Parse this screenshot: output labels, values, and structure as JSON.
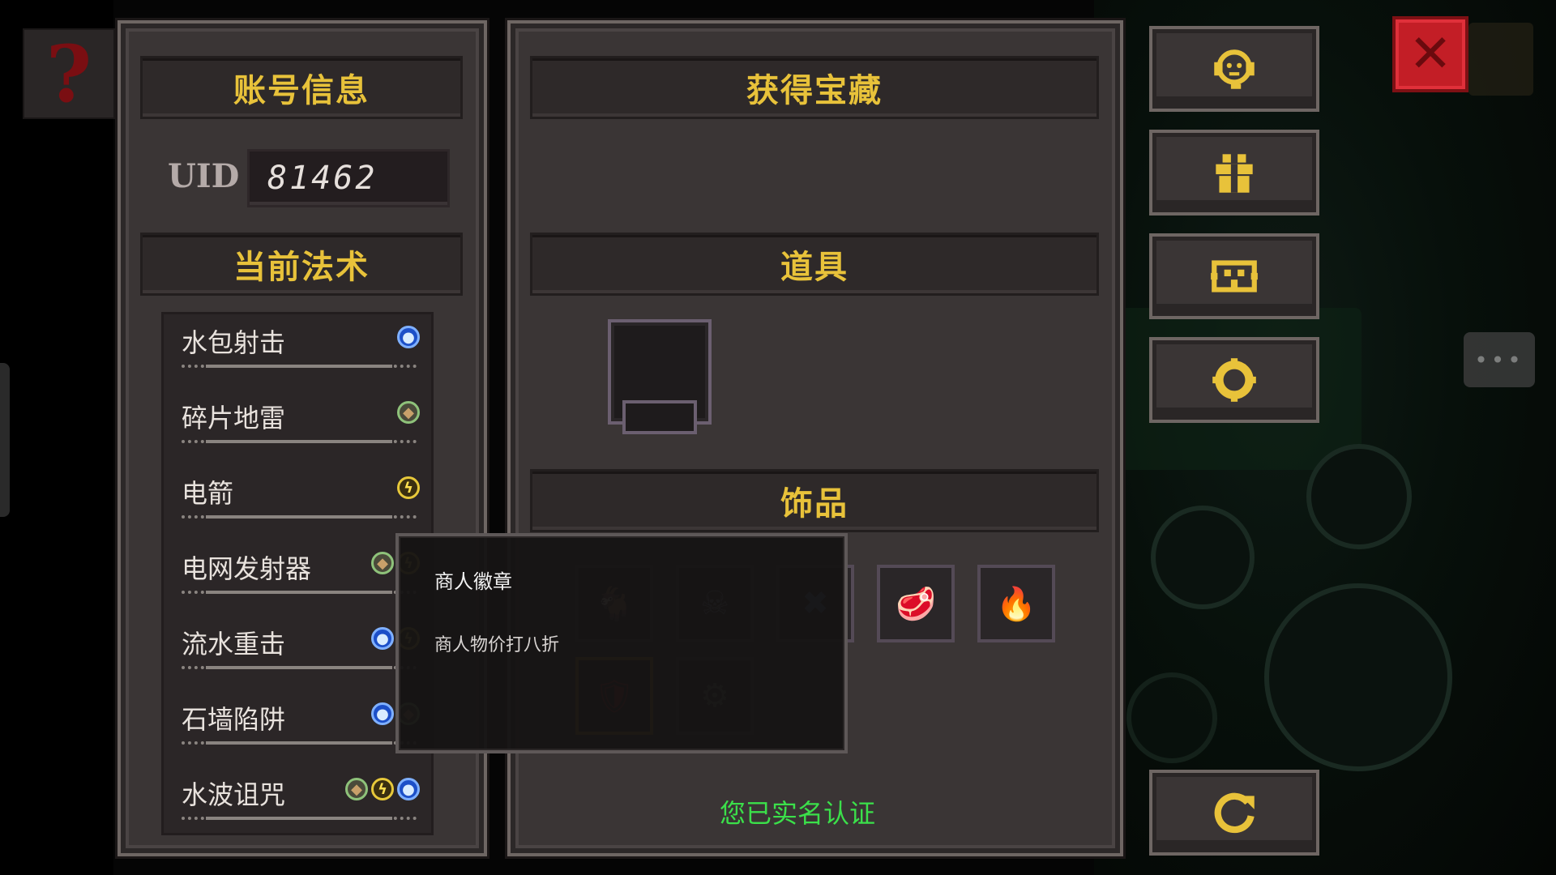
{
  "help_tile": {
    "symbol": "?"
  },
  "account_panel": {
    "header": "账号信息",
    "uid_label": "UID",
    "uid_value": "81462",
    "spells_header": "当前法术",
    "spells": [
      {
        "name": "水包射击",
        "elements": [
          "water"
        ]
      },
      {
        "name": "碎片地雷",
        "elements": [
          "earth"
        ]
      },
      {
        "name": "电箭",
        "elements": [
          "thunder"
        ]
      },
      {
        "name": "电网发射器",
        "elements": [
          "earth",
          "thunder"
        ]
      },
      {
        "name": "流水重击",
        "elements": [
          "water",
          "thunder"
        ]
      },
      {
        "name": "石墙陷阱",
        "elements": [
          "water",
          "earth"
        ]
      },
      {
        "name": "水波诅咒",
        "elements": [
          "earth",
          "thunder",
          "water"
        ]
      }
    ]
  },
  "treasure_panel": {
    "header": "获得宝藏",
    "props_header": "道具",
    "accessories_header": "饰品",
    "accessories": [
      {
        "icon": "goat-icon"
      },
      {
        "icon": "skull-necklace-icon"
      },
      {
        "icon": "blue-dagger-icon"
      },
      {
        "icon": "meat-icon"
      },
      {
        "icon": "fire-gem-icon"
      },
      {
        "icon": "merchant-badge-icon",
        "selected": true
      },
      {
        "icon": "tank-icon"
      }
    ],
    "realname_status": "您已实名认证"
  },
  "tooltip": {
    "title": "商人徽章",
    "description": "商人物价打八折"
  },
  "side_buttons": [
    {
      "icon": "support-headset-icon"
    },
    {
      "icon": "gift-icon"
    },
    {
      "icon": "coupon-icon"
    },
    {
      "icon": "settings-gear-icon"
    },
    {
      "icon": "refresh-icon"
    }
  ],
  "close_button": {
    "symbol": "✕"
  },
  "chat_bubble": {
    "symbol": "•••"
  },
  "colors": {
    "gold": "#e8c23a",
    "panel": "#3a3535",
    "green_text": "#3be04a",
    "water": "#1c4fc8",
    "thunder": "#e7c83a",
    "earth": "#8ec27a"
  }
}
